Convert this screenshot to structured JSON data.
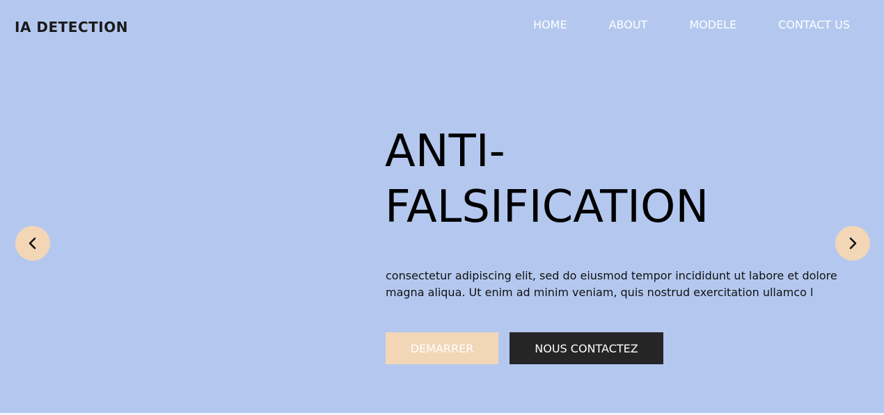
{
  "brand": {
    "name": "IA DETECTION"
  },
  "nav": {
    "items": [
      "HOME",
      "ABOUT",
      "MODELE",
      "CONTACT US"
    ]
  },
  "hero": {
    "title_line1": "ANTI-",
    "title_line2": "FALSIFICATION",
    "description": "consectetur adipiscing elit, sed do eiusmod tempor incididunt ut labore et dolore magna aliqua. Ut enim ad minim veniam, quis nostrud exercitation ullamco l",
    "primary_button": "DEMARRER",
    "secondary_button": "NOUS CONTACTEZ"
  },
  "carousel": {
    "prev_icon": "chevron-left-icon",
    "next_icon": "chevron-right-icon"
  },
  "colors": {
    "hero_background": "#b4c8ef",
    "accent": "#f2d6b6",
    "dark_button": "#252525",
    "nav_text": "#ffffff"
  }
}
